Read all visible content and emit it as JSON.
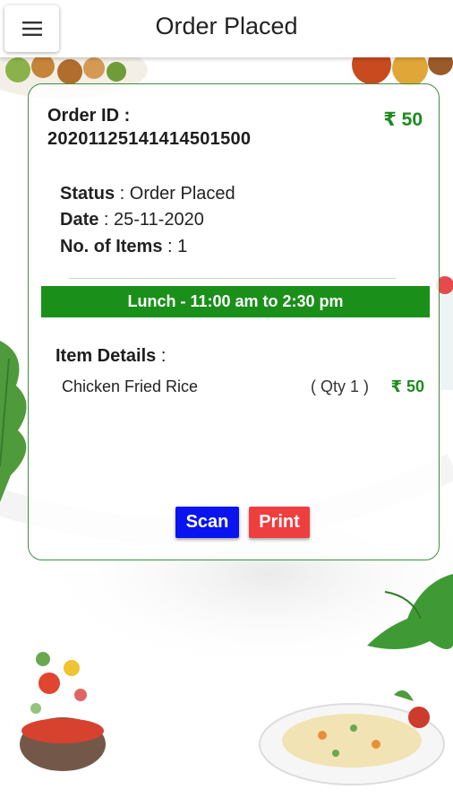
{
  "appbar": {
    "title": "Order Placed",
    "menu_icon": "hamburger-menu-icon"
  },
  "order": {
    "id_label": "Order ID :",
    "id_value": "20201125141414501500",
    "total": "₹ 50",
    "status_key": "Status",
    "status_value": " : Order Placed",
    "date_key": "Date",
    "date_value": " : 25-11-2020",
    "items_key": "No. of Items",
    "items_value": " : 1",
    "slot": "Lunch - 11:00 am to 2:30 pm",
    "item_details_key": "Item Details",
    "item_details_sep": " :",
    "items": [
      {
        "name": "Chicken Fried Rice",
        "qty": "( Qty 1 )",
        "price": "₹ 50"
      }
    ]
  },
  "actions": {
    "scan_label": "Scan",
    "print_label": "Print"
  },
  "colors": {
    "accent_green": "#1a8f1a",
    "scan_blue": "#0a14f0",
    "print_red": "#ef3e3e",
    "card_border": "#3f8f3f"
  }
}
